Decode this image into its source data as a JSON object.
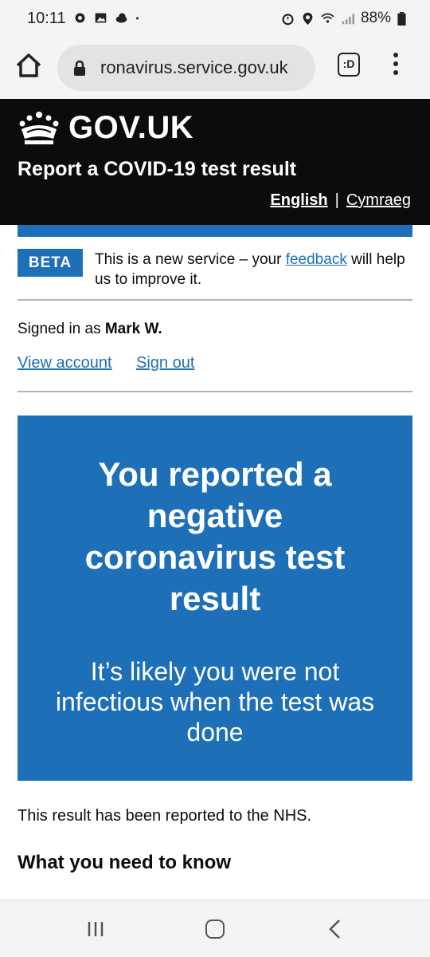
{
  "status_bar": {
    "time": "10:11",
    "battery": "88%"
  },
  "browser": {
    "url": "ronavirus.service.gov.uk",
    "tabs_label": ":D"
  },
  "header": {
    "logo_text": "GOV.UK",
    "service_name": "Report a COVID-19 test result",
    "lang_english": "English",
    "lang_separator": "|",
    "lang_welsh": "Cymraeg"
  },
  "beta": {
    "tag": "BETA",
    "text_before": "This is a new service – your ",
    "link": "feedback",
    "text_after": " will help us to improve it."
  },
  "account": {
    "signed_in_prefix": "Signed in as ",
    "user_name": "Mark W.",
    "view_account": "View account",
    "sign_out": "Sign out"
  },
  "panel": {
    "title": "You reported a negative coronavirus test result",
    "body": "It’s likely you were not infectious when the test was done"
  },
  "content": {
    "reported_text": "This result has been reported to the NHS.",
    "heading": "What you need to know"
  },
  "colors": {
    "govuk_blue": "#1d70b8",
    "header_black": "#0b0c0c"
  }
}
